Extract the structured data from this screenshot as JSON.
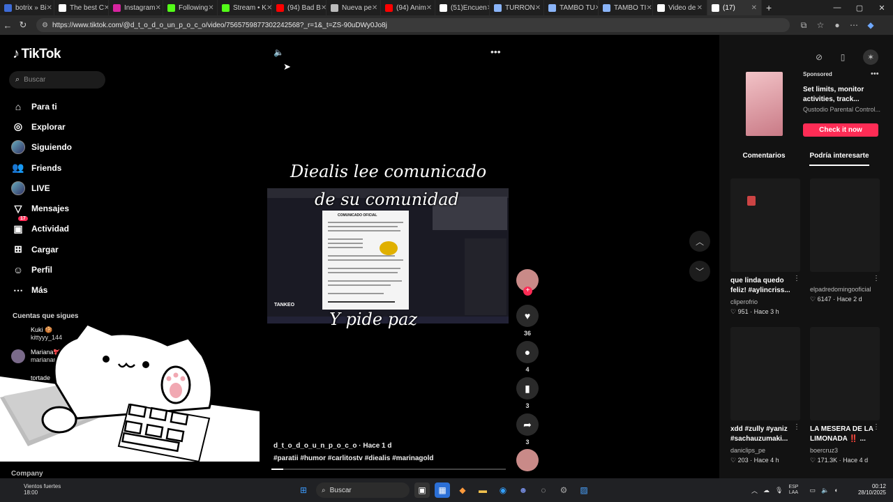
{
  "browser": {
    "tabs": [
      {
        "label": "botrix » Bi",
        "color": "#3d6bd6"
      },
      {
        "label": "The best C",
        "color": "#ffffff"
      },
      {
        "label": "Instagram",
        "color": "#d6249f"
      },
      {
        "label": "Following",
        "color": "#53fc18"
      },
      {
        "label": "Stream • K",
        "color": "#53fc18"
      },
      {
        "label": "(94) Bad B",
        "color": "#ff0000"
      },
      {
        "label": "Nueva pe",
        "color": "#bbbbbb"
      },
      {
        "label": "(94) Anim",
        "color": "#ff0000"
      },
      {
        "label": "(51)Encuen",
        "color": "#ffffff"
      },
      {
        "label": "TURRON",
        "color": "#8ab4f8"
      },
      {
        "label": "TAMBO TU",
        "color": "#8ab4f8"
      },
      {
        "label": "TAMBO TI",
        "color": "#8ab4f8"
      },
      {
        "label": "Video de",
        "color": "#ffffff"
      },
      {
        "label": "(17)",
        "color": "#ffffff"
      }
    ],
    "url": "https://www.tiktok.com/@d_t_o_d_o_un_p_o_c_o/video/7565759877302242568?_r=1&_t=ZS-90uDWy0Jo8j",
    "new_tab": "+",
    "win_min": "—",
    "win_max": "▢",
    "win_close": "✕"
  },
  "sidebar": {
    "logo": "TikTok",
    "search_placeholder": "Buscar",
    "menu": [
      {
        "label": "Para ti",
        "icon": "home-icon"
      },
      {
        "label": "Explorar",
        "icon": "compass-icon"
      },
      {
        "label": "Siguiendo",
        "icon": "following-avatar"
      },
      {
        "label": "Friends",
        "icon": "friends-icon"
      },
      {
        "label": "LIVE",
        "icon": "live-avatar"
      },
      {
        "label": "Mensajes",
        "icon": "messages-icon"
      },
      {
        "label": "Actividad",
        "icon": "activity-icon",
        "badge": "17"
      },
      {
        "label": "Cargar",
        "icon": "upload-icon"
      },
      {
        "label": "Perfil",
        "icon": "profile-icon"
      },
      {
        "label": "Más",
        "icon": "more-icon"
      }
    ],
    "following_header": "Cuentas que sigues",
    "following": [
      {
        "name": "Kuki 🍪",
        "handle": "kittyyy_144"
      },
      {
        "name": "Mariana🎀 M",
        "handle": "marianame"
      },
      {
        "name": "tortade",
        "handle": ""
      }
    ],
    "footer": "Company"
  },
  "video": {
    "caption_line1": "Diealis lee comunicado",
    "caption_line2": "de su comunidad",
    "caption_line3": "Y pide paz",
    "author": "d_t_o_d_o_u_n_p_o_c_o · Hace 1 d",
    "tags": "#paratii #humor #carlitostv #diealis #marinagold",
    "inner_overlay": "TANKEO",
    "doc_title": "COMUNICADO OFICIAL",
    "progress": 0.05
  },
  "actions": {
    "likes": "36",
    "comments": "4",
    "saves": "3",
    "shares": "3"
  },
  "right": {
    "ad": {
      "sponsored": "Sponsored",
      "title": "Set limits, monitor activities, track...",
      "brand": "Qustodio Parental Control...",
      "cta": "Check it now"
    },
    "tabs": {
      "comments": "Comentarios",
      "interest": "Podría interesarte"
    },
    "videos": [
      {
        "title": "que linda quedo feliz! #aylincriss...",
        "user": "cliperofrio",
        "likes": "951",
        "age": "Hace 3 h"
      },
      {
        "title": "",
        "user": "elpadredomingooficial",
        "likes": "6147",
        "age": "Hace 2 d"
      },
      {
        "title": "xdd #zully #yaniz #sachauzumaki...",
        "user": "daniclips_pe",
        "likes": "203",
        "age": "Hace 4 h"
      },
      {
        "title": "LA MESERA DE LA LIMONADA ‼️ ...",
        "user": "boercruz3",
        "likes": "171.3K",
        "age": "Hace 4 d"
      }
    ]
  },
  "taskbar": {
    "weather_title": "Vientos fuertes",
    "weather_temp": "18:00",
    "search": "Buscar",
    "lang": "ESP",
    "lang2": "LAA",
    "time": "00:12",
    "date": "28/10/2025"
  }
}
